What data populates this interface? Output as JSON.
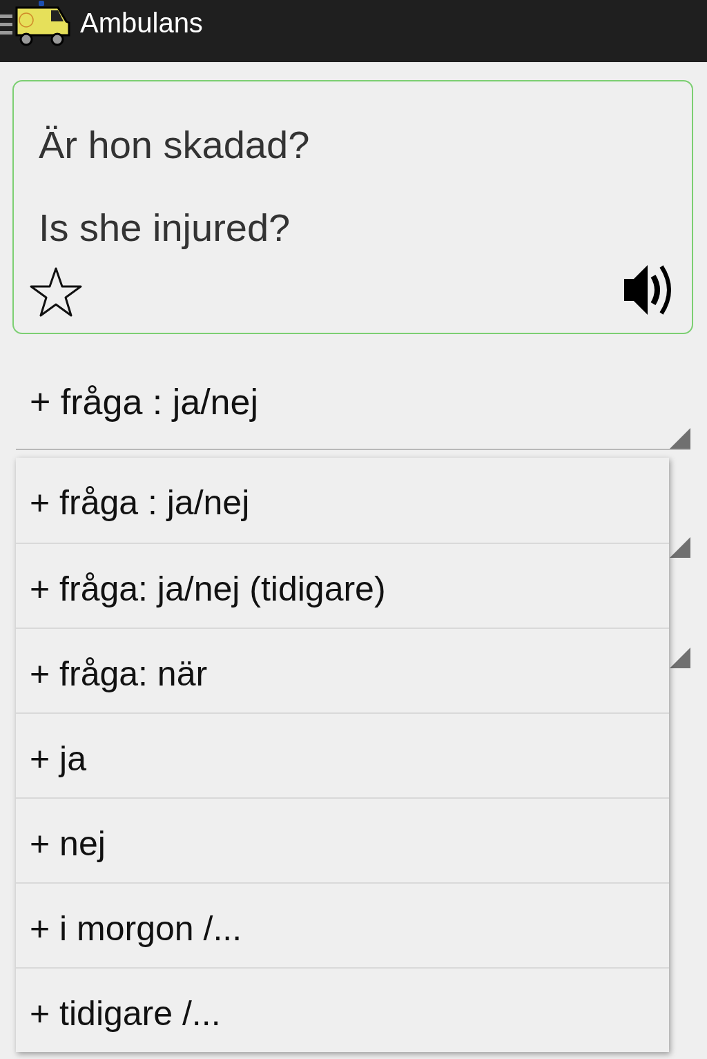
{
  "app_bar": {
    "title": "Ambulans"
  },
  "phrase_card": {
    "swedish": "Är hon skadad?",
    "english": "Is she injured?",
    "favorite": false
  },
  "spinner": {
    "value": "+ fråga : ja/nej"
  },
  "dropdown": {
    "items": [
      {
        "label": "+ fråga : ja/nej"
      },
      {
        "label": "+ fråga: ja/nej (tidigare)"
      },
      {
        "label": "+ fråga: när"
      },
      {
        "label": "+ ja"
      },
      {
        "label": "+ nej"
      },
      {
        "label": "+ i morgon /..."
      },
      {
        "label": "+ tidigare /..."
      }
    ]
  }
}
